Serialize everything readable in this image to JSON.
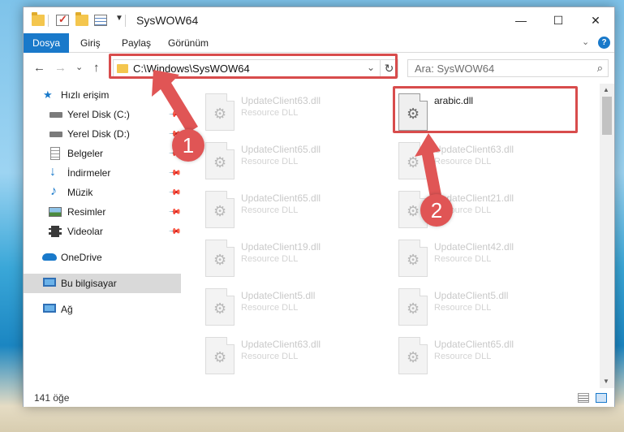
{
  "window": {
    "title": "SysWOW64",
    "minimize_glyph": "—",
    "maximize_glyph": "☐",
    "close_glyph": "✕"
  },
  "ribbon": {
    "file_tab": "Dosya",
    "tabs": [
      "Giriş",
      "Paylaş",
      "Görünüm"
    ],
    "help_glyph": "?"
  },
  "nav": {
    "back_glyph": "←",
    "forward_glyph": "→",
    "recent_glyph": "⌄",
    "up_glyph": "↑",
    "address": "C:\\Windows\\SysWOW64",
    "refresh_glyph": "↻",
    "search_placeholder": "Ara: SysWOW64"
  },
  "sidebar": {
    "items": [
      {
        "label": "Hızlı erişim",
        "icon": "star-icon"
      },
      {
        "label": "Yerel Disk (C:)",
        "icon": "drive-icon",
        "pinned": true
      },
      {
        "label": "Yerel Disk (D:)",
        "icon": "drive-icon",
        "pinned": true
      },
      {
        "label": "Belgeler",
        "icon": "documents-icon",
        "pinned": true
      },
      {
        "label": "İndirmeler",
        "icon": "download-icon",
        "pinned": true
      },
      {
        "label": "Müzik",
        "icon": "music-icon",
        "pinned": true
      },
      {
        "label": "Resimler",
        "icon": "pictures-icon",
        "pinned": true
      },
      {
        "label": "Videolar",
        "icon": "videos-icon",
        "pinned": true
      },
      {
        "label": "OneDrive",
        "icon": "cloud-icon"
      },
      {
        "label": "Bu bilgisayar",
        "icon": "computer-icon",
        "selected": true
      },
      {
        "label": "Ağ",
        "icon": "network-icon"
      }
    ]
  },
  "files": [
    {
      "name": "UpdateClient63.dll",
      "type": "Resource DLL"
    },
    {
      "name": "arabic.dll",
      "type": ""
    },
    {
      "name": "UpdateClient65.dll",
      "type": "Resource DLL"
    },
    {
      "name": "UpdateClient63.dll",
      "type": "Resource DLL"
    },
    {
      "name": "UpdateClient65.dll",
      "type": "Resource DLL"
    },
    {
      "name": "UpdateClient21.dll",
      "type": "Resource DLL"
    },
    {
      "name": "UpdateClient19.dll",
      "type": "Resource DLL"
    },
    {
      "name": "UpdateClient42.dll",
      "type": "Resource DLL"
    },
    {
      "name": "UpdateClient5.dll",
      "type": "Resource DLL"
    },
    {
      "name": "UpdateClient5.dll",
      "type": "Resource DLL"
    },
    {
      "name": "UpdateClient63.dll",
      "type": "Resource DLL"
    },
    {
      "name": "UpdateClient65.dll",
      "type": "Resource DLL"
    }
  ],
  "status": {
    "item_count": "141 öğe"
  },
  "annotations": {
    "step1": "1",
    "step2": "2",
    "color": "#e05555"
  }
}
